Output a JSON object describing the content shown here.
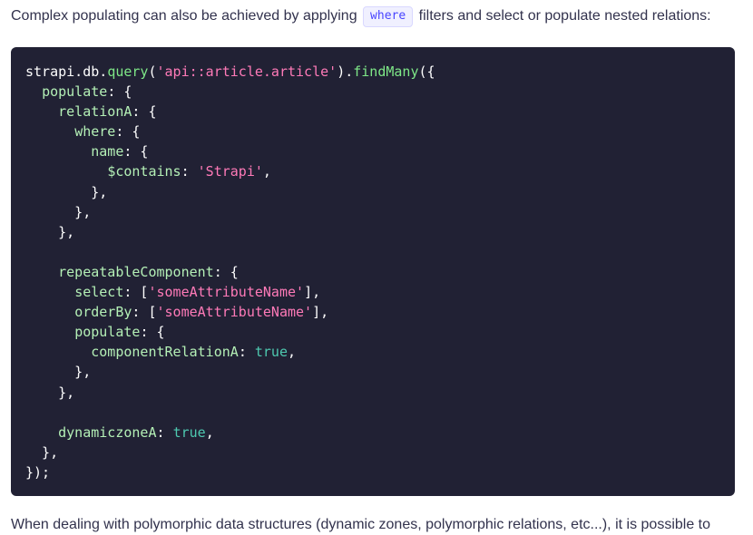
{
  "intro": {
    "before": "Complex populating can also be achieved by applying",
    "code": "where",
    "after": "filters and select or populate nested relations:"
  },
  "code_lines": [
    [
      {
        "t": "plain",
        "v": "strapi.db."
      },
      {
        "t": "fn",
        "v": "query"
      },
      {
        "t": "plain",
        "v": "("
      },
      {
        "t": "str",
        "v": "'api::article.article'"
      },
      {
        "t": "plain",
        "v": ")."
      },
      {
        "t": "fn",
        "v": "findMany"
      },
      {
        "t": "plain",
        "v": "({"
      }
    ],
    [
      {
        "t": "plain",
        "v": "  "
      },
      {
        "t": "key",
        "v": "populate"
      },
      {
        "t": "plain",
        "v": ": {"
      }
    ],
    [
      {
        "t": "plain",
        "v": "    "
      },
      {
        "t": "key",
        "v": "relationA"
      },
      {
        "t": "plain",
        "v": ": {"
      }
    ],
    [
      {
        "t": "plain",
        "v": "      "
      },
      {
        "t": "key",
        "v": "where"
      },
      {
        "t": "plain",
        "v": ": {"
      }
    ],
    [
      {
        "t": "plain",
        "v": "        "
      },
      {
        "t": "key",
        "v": "name"
      },
      {
        "t": "plain",
        "v": ": {"
      }
    ],
    [
      {
        "t": "plain",
        "v": "          "
      },
      {
        "t": "key",
        "v": "$contains"
      },
      {
        "t": "plain",
        "v": ": "
      },
      {
        "t": "str",
        "v": "'Strapi'"
      },
      {
        "t": "plain",
        "v": ","
      }
    ],
    [
      {
        "t": "plain",
        "v": "        },"
      }
    ],
    [
      {
        "t": "plain",
        "v": "      },"
      }
    ],
    [
      {
        "t": "plain",
        "v": "    },"
      }
    ],
    [
      {
        "t": "plain",
        "v": ""
      }
    ],
    [
      {
        "t": "plain",
        "v": "    "
      },
      {
        "t": "key",
        "v": "repeatableComponent"
      },
      {
        "t": "plain",
        "v": ": {"
      }
    ],
    [
      {
        "t": "plain",
        "v": "      "
      },
      {
        "t": "key",
        "v": "select"
      },
      {
        "t": "plain",
        "v": ": ["
      },
      {
        "t": "str",
        "v": "'someAttributeName'"
      },
      {
        "t": "plain",
        "v": "],"
      }
    ],
    [
      {
        "t": "plain",
        "v": "      "
      },
      {
        "t": "key",
        "v": "orderBy"
      },
      {
        "t": "plain",
        "v": ": ["
      },
      {
        "t": "str",
        "v": "'someAttributeName'"
      },
      {
        "t": "plain",
        "v": "],"
      }
    ],
    [
      {
        "t": "plain",
        "v": "      "
      },
      {
        "t": "key",
        "v": "populate"
      },
      {
        "t": "plain",
        "v": ": {"
      }
    ],
    [
      {
        "t": "plain",
        "v": "        "
      },
      {
        "t": "key",
        "v": "componentRelationA"
      },
      {
        "t": "plain",
        "v": ": "
      },
      {
        "t": "bool",
        "v": "true"
      },
      {
        "t": "plain",
        "v": ","
      }
    ],
    [
      {
        "t": "plain",
        "v": "      },"
      }
    ],
    [
      {
        "t": "plain",
        "v": "    },"
      }
    ],
    [
      {
        "t": "plain",
        "v": ""
      }
    ],
    [
      {
        "t": "plain",
        "v": "    "
      },
      {
        "t": "key",
        "v": "dynamiczoneA"
      },
      {
        "t": "plain",
        "v": ": "
      },
      {
        "t": "bool",
        "v": "true"
      },
      {
        "t": "plain",
        "v": ","
      }
    ],
    [
      {
        "t": "plain",
        "v": "  },"
      }
    ],
    [
      {
        "t": "plain",
        "v": "});"
      }
    ]
  ],
  "outro": {
    "text": "When dealing with polymorphic data structures (dynamic zones, polymorphic relations, etc...), it is possible to"
  },
  "colors": {
    "code_bg": "#212134",
    "plain": "#ffffff",
    "function": "#7ee787",
    "string": "#ff7ab8",
    "key": "#b4f0b6",
    "boolean": "#4ec9b0",
    "inline_code": "#4945ff"
  }
}
